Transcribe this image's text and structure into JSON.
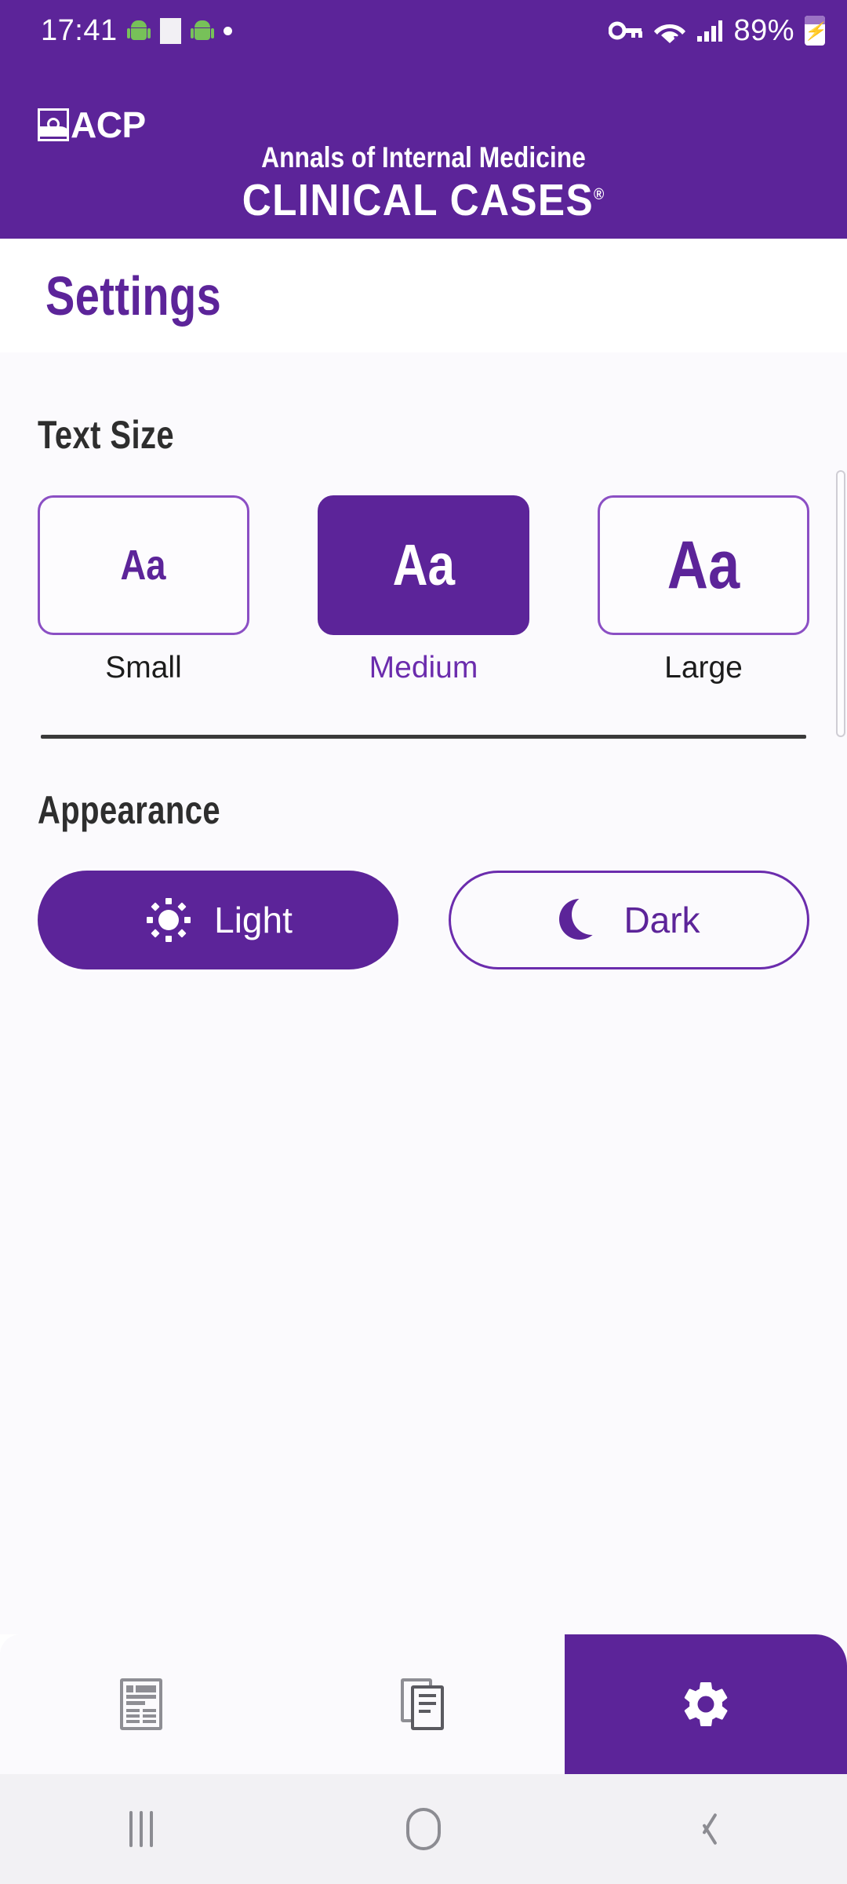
{
  "status_bar": {
    "time": "17:41",
    "battery_percent": "89%",
    "icons": [
      "android-robot-icon",
      "white-square-icon",
      "android-robot-icon",
      "dot-icon",
      "vpn-key-icon",
      "wifi-icon",
      "cellular-signal-icon",
      "battery-charging-icon"
    ]
  },
  "header": {
    "logo_text": "ACP",
    "brand_line1": "Annals of Internal Medicine",
    "brand_line2": "CLINICAL CASES",
    "brand_registered": "®"
  },
  "page": {
    "title": "Settings"
  },
  "text_size": {
    "heading": "Text Size",
    "sample_glyph": "Aa",
    "options": [
      {
        "label": "Small",
        "selected": false
      },
      {
        "label": "Medium",
        "selected": true
      },
      {
        "label": "Large",
        "selected": false
      }
    ]
  },
  "appearance": {
    "heading": "Appearance",
    "options": [
      {
        "label": "Light",
        "icon": "sun-icon",
        "selected": true
      },
      {
        "label": "Dark",
        "icon": "moon-icon",
        "selected": false
      }
    ]
  },
  "tabbar": {
    "tabs": [
      {
        "name": "articles",
        "icon": "newspaper-icon",
        "active": false
      },
      {
        "name": "cases",
        "icon": "documents-icon",
        "active": false
      },
      {
        "name": "settings",
        "icon": "gear-icon",
        "active": true
      }
    ]
  },
  "navbar": {
    "buttons": [
      "recents-icon",
      "home-icon",
      "back-icon"
    ]
  },
  "colors": {
    "brand_purple": "#5C2499",
    "accent_purple": "#6B2CAD",
    "outline_purple": "#8B4FC4",
    "content_bg": "#FBFAFD",
    "heading_dark": "#2E2E2E"
  }
}
